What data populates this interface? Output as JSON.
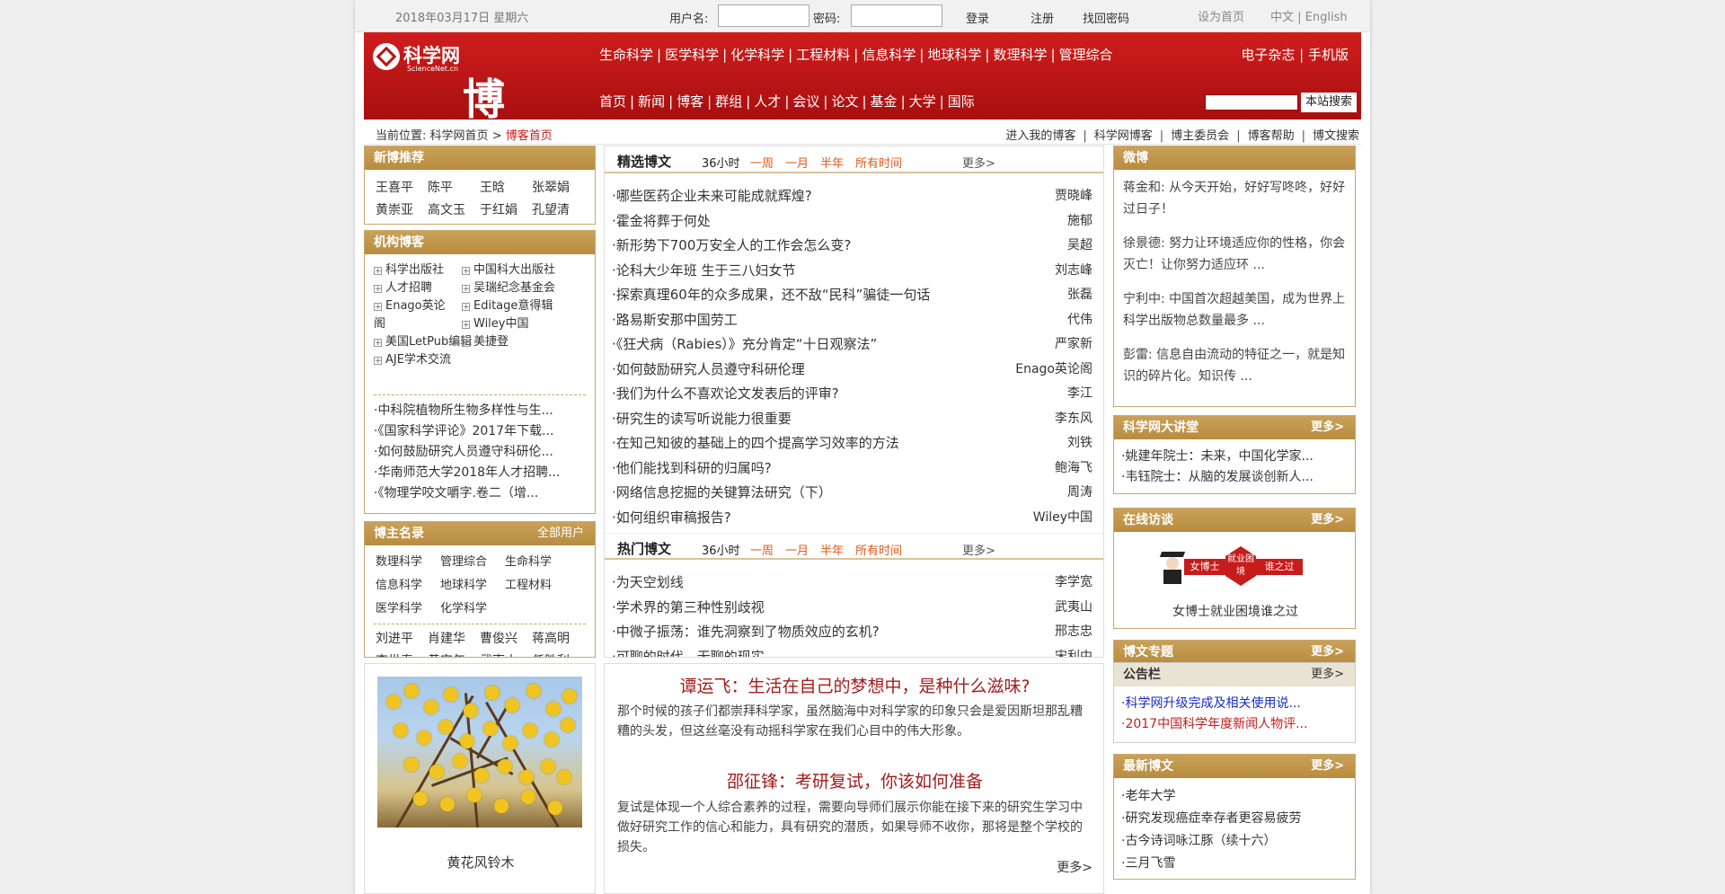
{
  "topbar": {
    "date": "2018年03月17日 星期六",
    "username_label": "用户名:",
    "password_label": "密码:",
    "login": "登录",
    "register": "注册",
    "recover": "找回密码",
    "set_home": "设为首页",
    "lang": "中文 | English"
  },
  "header": {
    "logo_cn": "科学网",
    "logo_en": "ScienceNet.cn",
    "logo_blog": "博客",
    "nav_subjects": [
      "生命科学",
      "医学科学",
      "化学科学",
      "工程材料",
      "信息科学",
      "地球科学",
      "数理科学",
      "管理综合"
    ],
    "nav_right": "电子杂志 | 手机版",
    "nav_main": [
      "首页",
      "新闻",
      "博客",
      "群组",
      "人才",
      "会议",
      "论文",
      "基金",
      "大学",
      "国际"
    ],
    "search_button": "本站搜索"
  },
  "breadcrumb": {
    "label": "当前位置:",
    "home": "科学网首页",
    "arrow": ">",
    "current": "博客首页"
  },
  "toplinks": [
    "进入我的博客",
    "科学网博客",
    "博主委员会",
    "博客帮助",
    "博文搜索"
  ],
  "new_blogs": {
    "title": "新博推荐",
    "names": [
      "王喜平",
      "陈平",
      "王晗",
      "张翠娟",
      "黄崇亚",
      "高文玉",
      "于红娟",
      "孔望清"
    ]
  },
  "institution_blogs": {
    "title": "机构博客",
    "items": [
      "科学出版社",
      "中国科大出版社",
      "人才招聘",
      "吴瑞纪念基金会",
      "Enago英论阁",
      "Editage意得辑",
      "Wiley中国",
      "美国LetPub编辑",
      "美捷登",
      "AJE学术交流"
    ],
    "links": [
      "·中科院植物所生物多样性与生...",
      "·《国家科学评论》2017年下载...",
      "·如何鼓励研究人员遵守科研伦...",
      "·华南师范大学2018年人才招聘...",
      "·《物理学咬文嚼字.卷二（增..."
    ]
  },
  "bloggers": {
    "title": "博主名录",
    "all_users": "全部用户",
    "categories": [
      "数理科学",
      "管理综合",
      "生命科学",
      "信息科学",
      "地球科学",
      "工程材料",
      "医学科学",
      "化学科学"
    ],
    "names": [
      "刘进平",
      "肖建华",
      "曹俊兴",
      "蒋高明",
      "李世春",
      "黄安年",
      "武夷山",
      "任胜利"
    ]
  },
  "featured": {
    "title": "精选博文",
    "filters": [
      "36小时",
      "一周",
      "一月",
      "半年",
      "所有时间"
    ],
    "more": "更多>",
    "articles": [
      {
        "title": "·哪些医药企业未来可能成就辉煌?",
        "author": "贾晓峰"
      },
      {
        "title": "·霍金将葬于何处",
        "author": "施郁"
      },
      {
        "title": "·新形势下700万安全人的工作会怎么变?",
        "author": "吴超"
      },
      {
        "title": "·论科大少年班 生于三八妇女节",
        "author": "刘志峰"
      },
      {
        "title": "·探索真理60年的众多成果，还不敌“民科”骗徒一句话",
        "author": "张磊"
      },
      {
        "title": "·路易斯安那中国劳工",
        "author": "代伟"
      },
      {
        "title": "·《狂犬病（Rabies）》充分肯定“十日观察法”",
        "author": "严家新"
      },
      {
        "title": "·如何鼓励研究人员遵守科研伦理",
        "author": "Enago英论阁"
      },
      {
        "title": "·我们为什么不喜欢论文发表后的评审?",
        "author": "李江"
      },
      {
        "title": "·研究生的读写听说能力很重要",
        "author": "李东风"
      },
      {
        "title": "·在知己知彼的基础上的四个提高学习效率的方法",
        "author": "刘铁"
      },
      {
        "title": "·他们能找到科研的归属吗?",
        "author": "鲍海飞"
      },
      {
        "title": "·网络信息挖掘的关键算法研究（下）",
        "author": "周涛"
      },
      {
        "title": "·如何组织审稿报告?",
        "author": "Wiley中国"
      }
    ]
  },
  "hot": {
    "title": "热门博文",
    "filters": [
      "36小时",
      "一周",
      "一月",
      "半年",
      "所有时间"
    ],
    "more": "更多>",
    "articles": [
      {
        "title": "·为天空划线",
        "author": "李学宽"
      },
      {
        "title": "·学术界的第三种性别歧视",
        "author": "武夷山"
      },
      {
        "title": "·中微子振荡：谁先洞察到了物质效应的玄机?",
        "author": "邢志忠"
      },
      {
        "title": "·可聊的时代，无聊的现实......",
        "author": "宋利中"
      }
    ]
  },
  "weibo": {
    "title": "微博",
    "posts": [
      "蒋金和: 从今天开始，好好写咚咚，好好过日子！",
      "徐景德: 努力让环境适应你的性格，你会灭亡！让你努力适应环 ...",
      "宁利中: 中国首次超越美国，成为世界上科学出版物总数量最多 ...",
      "彭雷: 信息自由流动的特征之一，就是知识的碎片化。知识传 ..."
    ]
  },
  "lectures": {
    "title": "科学网大讲堂",
    "more": "更多>",
    "items": [
      "·姚建年院士：未来，中国化学家...",
      "·韦钰院士：从脑的发展谈创新人..."
    ]
  },
  "interview": {
    "title": "在线访谈",
    "more": "更多>",
    "badge_a": "女博士",
    "badge_b": "就业困境",
    "badge_c": "谁之过",
    "caption": "女博士就业困境谁之过"
  },
  "topics": {
    "title": "博文专题",
    "more": "更多>"
  },
  "notice": {
    "title": "公告栏",
    "more": "更多>",
    "items": [
      "·科学网升级完成及相关使用说...",
      "·2017中国科学年度新闻人物评..."
    ]
  },
  "latest": {
    "title": "最新博文",
    "more": "更多>",
    "items": [
      "·老年大学",
      "·研究发现癌症幸存者更容易疲劳",
      "·古今诗词咏江豚（续十六）",
      "·三月飞雪"
    ]
  },
  "photo": {
    "caption": "黄花风铃木"
  },
  "feature_story": {
    "title1": "谭运飞：生活在自己的梦想中，是种什么滋味?",
    "body1": "那个时候的孩子们都崇拜科学家，虽然脑海中对科学家的印象只会是爱因斯坦那乱糟糟的头发，但这丝毫没有动摇科学家在我们心目中的伟大形象。",
    "title2": "邵征锋：考研复试，你该如何准备",
    "body2": "复试是体现一个人综合素养的过程，需要向导师们展示你能在接下来的研究生学习中做好研究工作的信心和能力，具有研究的潜质，如果导师不收你，那将是整个学校的损失。",
    "more": "更多>"
  },
  "colors": {
    "brand_red": "#b51515",
    "panel_gold": "#c09650",
    "filter_orange": "#e05a1b"
  }
}
